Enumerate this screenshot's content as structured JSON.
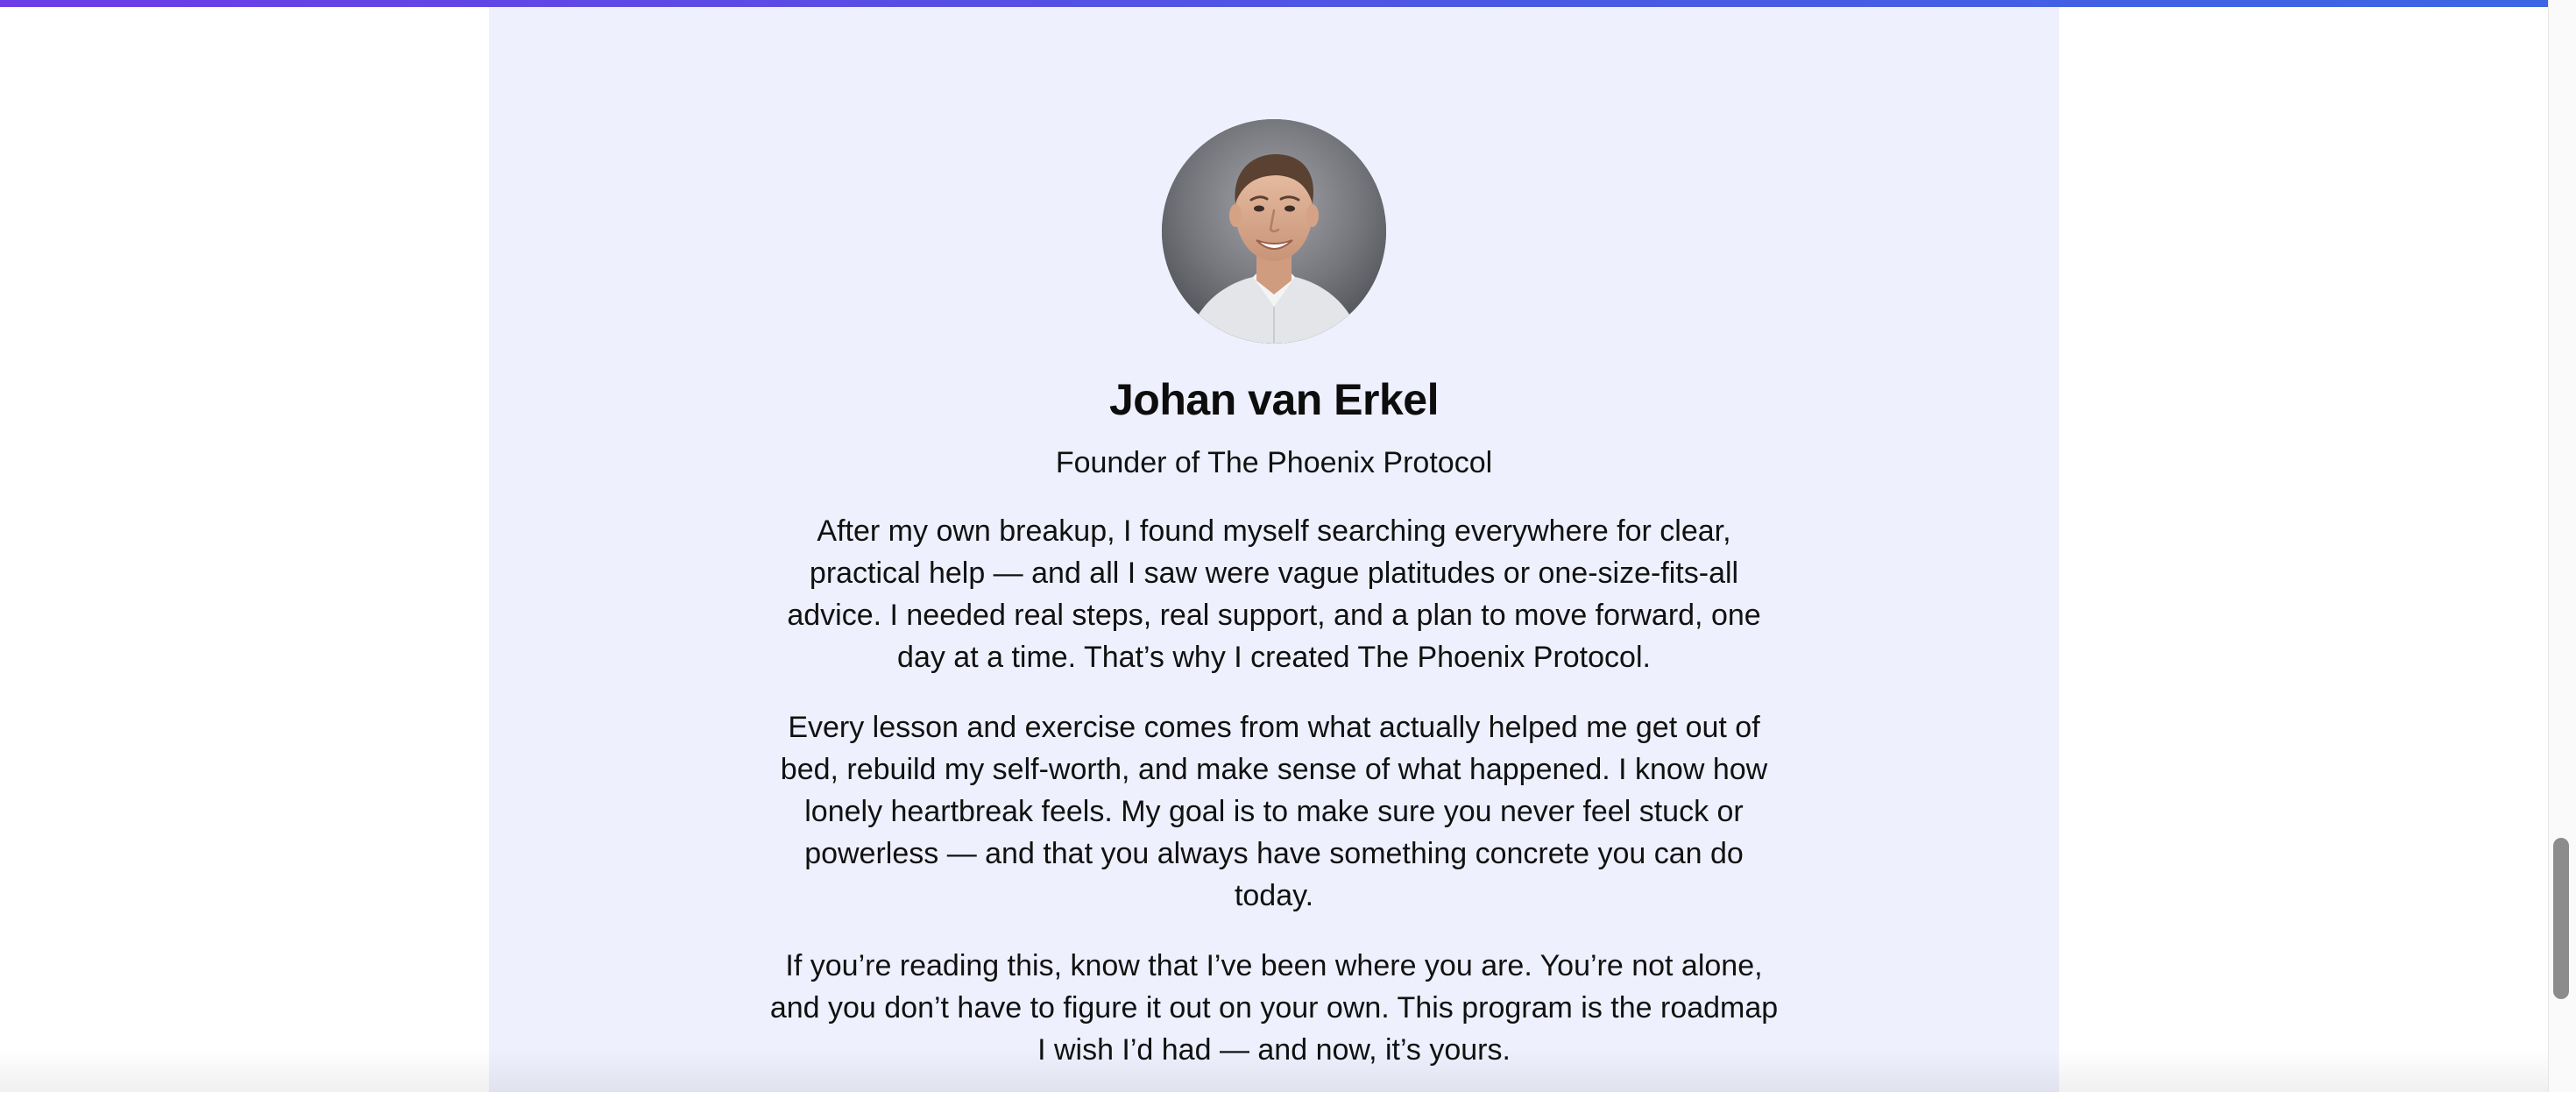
{
  "profile": {
    "name": "Johan van Erkel",
    "subtitle": "Founder of The Phoenix Protocol",
    "avatar_alt": "Portrait photo of Johan van Erkel",
    "bio": [
      "After my own breakup, I found myself searching everywhere for clear, practical help — and all I saw were vague platitudes or one-size-fits-all advice. I needed real steps, real support, and a plan to move forward, one day at a time. That’s why I created The Phoenix Protocol.",
      "Every lesson and exercise comes from what actually helped me get out of bed, rebuild my self-worth, and make sense of what happened. I know how lonely heartbreak feels. My goal is to make sure you never feel stuck or powerless — and that you always have something concrete you can do today.",
      "If you’re reading this, know that I’ve been where you are. You’re not alone, and you don’t have to figure it out on your own. This program is the roadmap I wish I’d had — and now, it’s yours."
    ]
  },
  "theme": {
    "panel_background": "#eef0fd",
    "top_bar_gradient_start": "#6d3de6",
    "top_bar_gradient_end": "#3d66e4"
  }
}
